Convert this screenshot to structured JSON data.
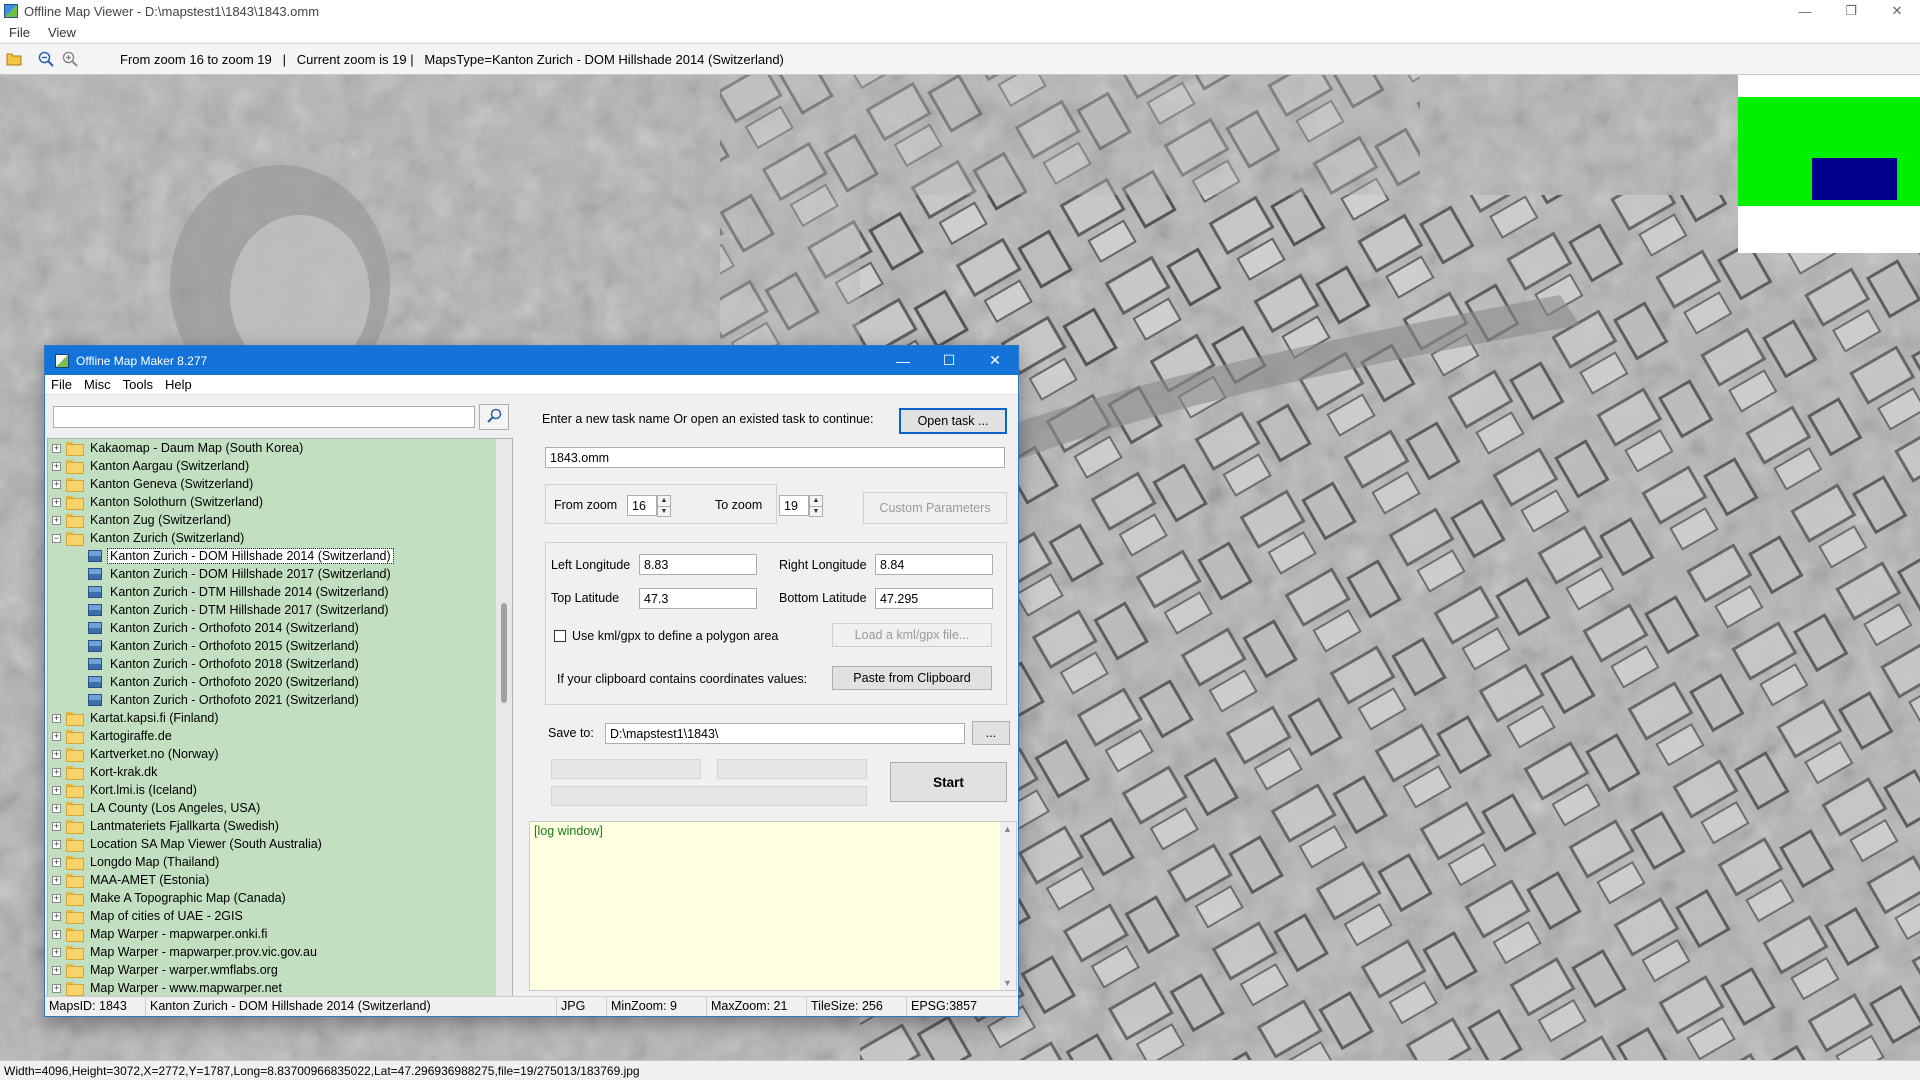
{
  "viewer": {
    "title": "Offline Map Viewer - D:\\mapstest1\\1843\\1843.omm",
    "menu": [
      "File",
      "View"
    ],
    "toolbar_info": "From zoom 16 to zoom 19   |   Current zoom is 19 |   MapsType=Kanton Zurich - DOM Hillshade 2014 (Switzerland)",
    "icons": [
      "open-folder-icon",
      "zoom-out-icon",
      "zoom-in-icon"
    ],
    "statusbar": "Width=4096,Height=3072,X=2772,Y=1787,Long=8.83700966835022,Lat=47.296936988275,file=19/275013/183769.jpg",
    "minimap_colors": {
      "frame": "#00f000",
      "viewport": "#00008b"
    }
  },
  "maker": {
    "title": "Offline Map Maker 8.277",
    "menu": [
      "File",
      "Misc",
      "Tools",
      "Help"
    ],
    "search": {
      "value": ""
    },
    "tree": [
      {
        "label": "Kakaomap - Daum Map (South Korea)",
        "level": 0,
        "expander": "+"
      },
      {
        "label": "Kanton Aargau (Switzerland)",
        "level": 0,
        "expander": "+"
      },
      {
        "label": "Kanton Geneva (Switzerland)",
        "level": 0,
        "expander": "+"
      },
      {
        "label": "Kanton Solothurn (Switzerland)",
        "level": 0,
        "expander": "+"
      },
      {
        "label": "Kanton Zug (Switzerland)",
        "level": 0,
        "expander": "+"
      },
      {
        "label": "Kanton Zurich (Switzerland)",
        "level": 0,
        "expander": "−"
      },
      {
        "label": "Kanton Zurich - DOM Hillshade 2014 (Switzerland)",
        "level": 1,
        "selected": true
      },
      {
        "label": "Kanton Zurich - DOM Hillshade 2017 (Switzerland)",
        "level": 1
      },
      {
        "label": "Kanton Zurich - DTM Hillshade 2014 (Switzerland)",
        "level": 1
      },
      {
        "label": "Kanton Zurich - DTM Hillshade 2017 (Switzerland)",
        "level": 1
      },
      {
        "label": "Kanton Zurich - Orthofoto 2014 (Switzerland)",
        "level": 1
      },
      {
        "label": "Kanton Zurich - Orthofoto 2015 (Switzerland)",
        "level": 1
      },
      {
        "label": "Kanton Zurich - Orthofoto 2018 (Switzerland)",
        "level": 1
      },
      {
        "label": "Kanton Zurich - Orthofoto 2020 (Switzerland)",
        "level": 1
      },
      {
        "label": "Kanton Zurich - Orthofoto 2021 (Switzerland)",
        "level": 1
      },
      {
        "label": "Kartat.kapsi.fi (Finland)",
        "level": 0,
        "expander": "+"
      },
      {
        "label": "Kartogiraffe.de",
        "level": 0,
        "expander": "+"
      },
      {
        "label": "Kartverket.no (Norway)",
        "level": 0,
        "expander": "+"
      },
      {
        "label": "Kort-krak.dk",
        "level": 0,
        "expander": "+"
      },
      {
        "label": "Kort.lmi.is (Iceland)",
        "level": 0,
        "expander": "+"
      },
      {
        "label": "LA County (Los Angeles, USA)",
        "level": 0,
        "expander": "+"
      },
      {
        "label": "Lantmateriets Fjallkarta (Swedish)",
        "level": 0,
        "expander": "+"
      },
      {
        "label": "Location SA Map Viewer (South Australia)",
        "level": 0,
        "expander": "+"
      },
      {
        "label": "Longdo Map (Thailand)",
        "level": 0,
        "expander": "+"
      },
      {
        "label": "MAA-AMET (Estonia)",
        "level": 0,
        "expander": "+"
      },
      {
        "label": "Make A Topographic Map (Canada)",
        "level": 0,
        "expander": "+"
      },
      {
        "label": "Map of cities of UAE - 2GIS",
        "level": 0,
        "expander": "+"
      },
      {
        "label": "Map Warper - mapwarper.onki.fi",
        "level": 0,
        "expander": "+"
      },
      {
        "label": "Map Warper - mapwarper.prov.vic.gov.au",
        "level": 0,
        "expander": "+"
      },
      {
        "label": "Map Warper - warper.wmflabs.org",
        "level": 0,
        "expander": "+"
      },
      {
        "label": "Map Warper - www.mapwarper.net",
        "level": 0,
        "expander": "+"
      }
    ],
    "task_prompt": "Enter a new task name Or open an existed task to continue:",
    "open_task_label": "Open task ...",
    "task_name": "1843.omm",
    "from_zoom_label": "From zoom",
    "from_zoom": "16",
    "to_zoom_label": "To zoom",
    "to_zoom": "19",
    "custom_params_label": "Custom Parameters",
    "left_lon_label": "Left Longitude",
    "left_lon": "8.83",
    "right_lon_label": "Right Longitude",
    "right_lon": "8.84",
    "top_lat_label": "Top Latitude",
    "top_lat": "47.3",
    "bottom_lat_label": "Bottom Latitude",
    "bottom_lat": "47.295",
    "kml_label": "Use kml/gpx to define a polygon area",
    "kml_checked": false,
    "load_kml_label": "Load a kml/gpx file...",
    "clipboard_label": "If your clipboard contains coordinates values:",
    "paste_label": "Paste from Clipboard",
    "save_to_label": "Save to:",
    "save_to": "D:\\mapstest1\\1843\\",
    "browse_label": "...",
    "start_label": "Start",
    "log_text": "[log window]",
    "status": {
      "maps_id": "MapsID: 1843",
      "map_name": "Kanton Zurich - DOM Hillshade 2014 (Switzerland)",
      "format": "JPG",
      "min_zoom": "MinZoom: 9",
      "max_zoom": "MaxZoom: 21",
      "tile_size": "TileSize: 256",
      "epsg": "EPSG:3857"
    }
  }
}
